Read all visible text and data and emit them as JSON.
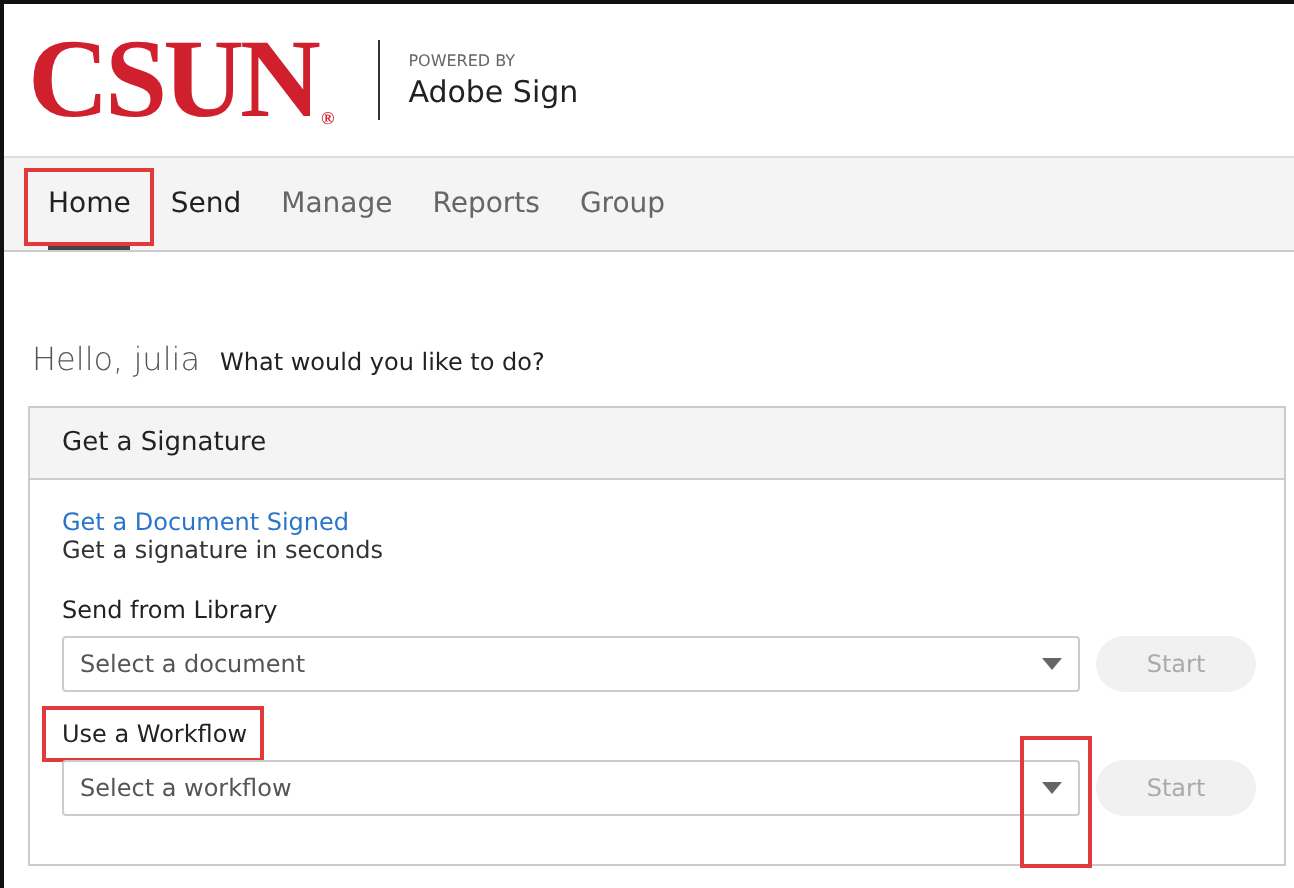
{
  "header": {
    "logo": "CSUN",
    "logo_mark": "®",
    "powered_by": "POWERED BY",
    "product": "Adobe Sign"
  },
  "nav": [
    {
      "label": "Home",
      "selected": true,
      "highlighted": true
    },
    {
      "label": "Send",
      "selected": false,
      "highlighted": false
    },
    {
      "label": "Manage",
      "selected": false,
      "highlighted": false
    },
    {
      "label": "Reports",
      "selected": false,
      "highlighted": false
    },
    {
      "label": "Group",
      "selected": false,
      "highlighted": false
    }
  ],
  "greeting": {
    "hello": "Hello, julia",
    "prompt": "What would you like to do?"
  },
  "card": {
    "title": "Get a Signature",
    "link": "Get a Document Signed",
    "link_caption": "Get a signature in seconds",
    "rows": [
      {
        "label": "Send from Library",
        "label_highlighted": false,
        "placeholder": "Select a document",
        "caret_highlighted": false,
        "button": {
          "label": "Start",
          "disabled": true
        }
      },
      {
        "label": "Use a Workflow",
        "label_highlighted": true,
        "placeholder": "Select a workflow",
        "caret_highlighted": true,
        "button": {
          "label": "Start",
          "disabled": true
        }
      }
    ]
  }
}
